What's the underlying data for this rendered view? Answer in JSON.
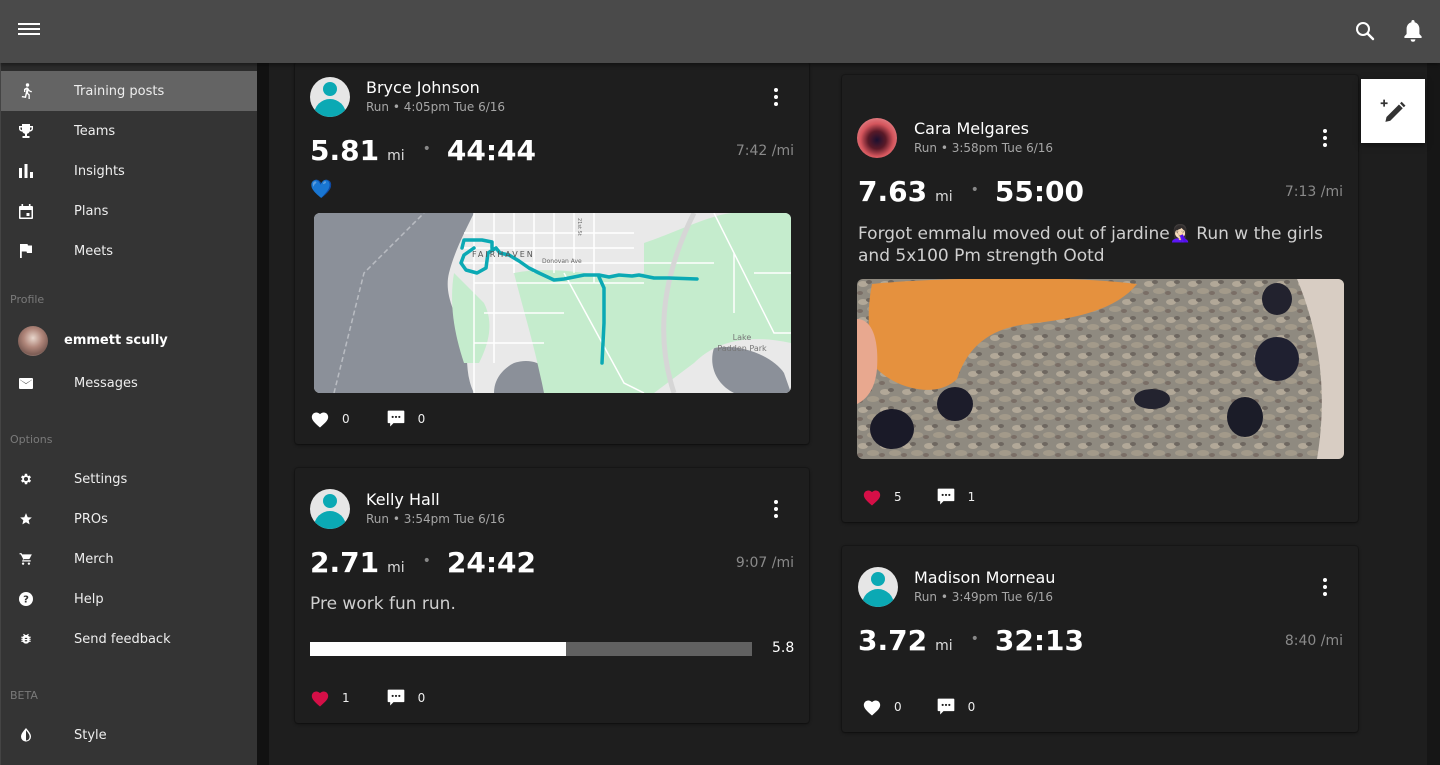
{
  "appbar": {
    "menu_icon": "hamburger-menu-icon",
    "search_icon": "search-icon",
    "notifications_icon": "bell-icon"
  },
  "sidebar": {
    "nav": [
      {
        "label": "Training posts",
        "icon": "running-person-icon",
        "active": true
      },
      {
        "label": "Teams",
        "icon": "trophy-icon"
      },
      {
        "label": "Insights",
        "icon": "bar-chart-icon"
      },
      {
        "label": "Plans",
        "icon": "calendar-icon"
      },
      {
        "label": "Meets",
        "icon": "flag-icon"
      }
    ],
    "profile_section": "Profile",
    "profile": {
      "name": "emmett scully"
    },
    "messages": {
      "label": "Messages",
      "icon": "mail-icon"
    },
    "options_section": "Options",
    "options": [
      {
        "label": "Settings",
        "icon": "gear-icon"
      },
      {
        "label": "PROs",
        "icon": "star-icon"
      },
      {
        "label": "Merch",
        "icon": "cart-icon"
      },
      {
        "label": "Help",
        "icon": "help-icon"
      },
      {
        "label": "Send feedback",
        "icon": "bug-icon"
      }
    ],
    "beta_section": "BETA",
    "beta": [
      {
        "label": "Style",
        "icon": "contrast-drop-icon"
      }
    ]
  },
  "fab": {
    "icon": "new-post-pencil-icon"
  },
  "posts": [
    {
      "author": "Bryce Johnson",
      "meta": "Run • 4:05pm Tue 6/16",
      "distance": "5.81",
      "unit": "mi",
      "separator": "•",
      "duration": "44:44",
      "pace": "7:42 /mi",
      "emoji": "💙",
      "map": {
        "labels": [
          "FAIRHAVEN",
          "Donovan Ave",
          "21st St",
          "Lake",
          "Padden Park"
        ]
      },
      "likes": "0",
      "comments": "0",
      "liked": false
    },
    {
      "author": "Kelly Hall",
      "meta": "Run • 3:54pm Tue 6/16",
      "distance": "2.71",
      "unit": "mi",
      "separator": "•",
      "duration": "24:42",
      "pace": "9:07 /mi",
      "description": "Pre work fun run.",
      "rating": {
        "value": 5.8,
        "max": 10,
        "label": "5.8"
      },
      "likes": "1",
      "comments": "0",
      "liked": true
    },
    {
      "author": "Cara Melgares",
      "meta": "Run • 3:58pm Tue 6/16",
      "distance": "7.63",
      "unit": "mi",
      "separator": "•",
      "duration": "55:00",
      "pace": "7:13 /mi",
      "description": "Forgot emmalu moved out of jardine🤦🏻‍♀️ Run w the girls and 5x100 Pm strength Ootd",
      "likes": "5",
      "comments": "1",
      "liked": true
    },
    {
      "author": "Madison Morneau",
      "meta": "Run • 3:49pm Tue 6/16",
      "distance": "3.72",
      "unit": "mi",
      "separator": "•",
      "duration": "32:13",
      "pace": "8:40 /mi",
      "likes": "0",
      "comments": "0",
      "liked": false
    }
  ],
  "colors": {
    "accent_teal": "#0ba9b4",
    "like_red": "#d50f47",
    "appbar": "#4a4a4a",
    "sidebar": "#343434",
    "card": "#1e1e1e"
  }
}
